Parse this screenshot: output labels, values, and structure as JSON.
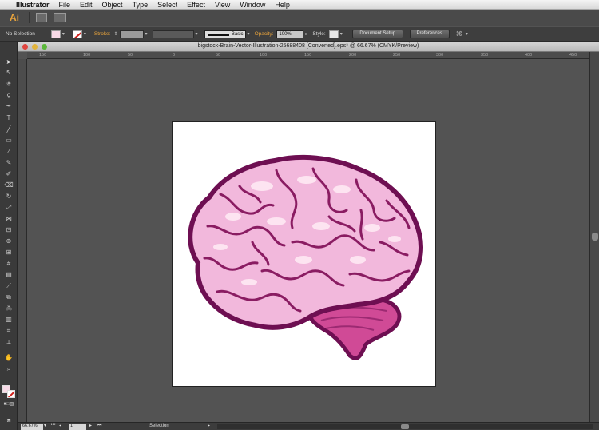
{
  "menubar": {
    "app_name": "Illustrator",
    "items": [
      "File",
      "Edit",
      "Object",
      "Type",
      "Select",
      "Effect",
      "View",
      "Window",
      "Help"
    ]
  },
  "appbar": {
    "logo_text": "Ai"
  },
  "control": {
    "selection_label": "No Selection",
    "stroke_label": "Stroke:",
    "brush_value": "Basic",
    "opacity_label": "Opacity:",
    "opacity_value": "100%",
    "style_label": "Style:",
    "document_setup_label": "Document Setup",
    "preferences_label": "Preferences"
  },
  "document": {
    "title": "bigstock-Brain-Vector-Illustration-25688408 [Converted].eps* @ 66.67% (CMYK/Preview)"
  },
  "ruler": {
    "ticks": [
      "150",
      "100",
      "50",
      "0",
      "50",
      "100",
      "150",
      "200",
      "250",
      "300",
      "350",
      "400",
      "450"
    ]
  },
  "status": {
    "zoom": "66.67%",
    "page": "1",
    "tool_mode": "Selection"
  },
  "colors": {
    "fill_swatch": "#f7d9e6",
    "brain_outline": "#6e0f52",
    "brain_fill": "#f2b8dc",
    "brainstem": "#d04a96"
  }
}
